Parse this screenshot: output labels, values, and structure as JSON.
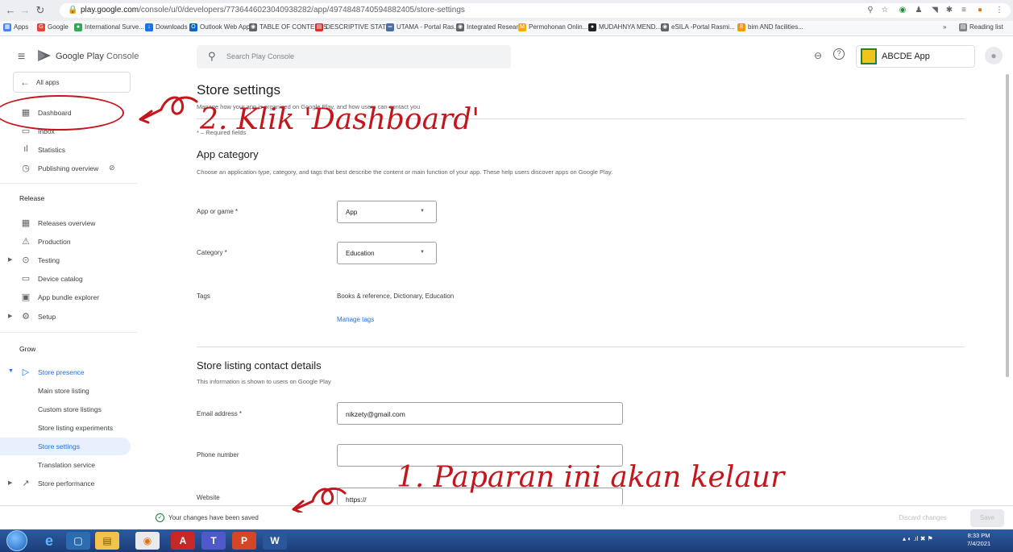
{
  "browser": {
    "url_prefix": "play.google.com",
    "url_rest": "/console/u/0/developers/7736446023040938282/app/4974848740594882405/store-settings",
    "bookmarks": [
      "Apps",
      "Google",
      "International Surve...",
      "Downloads",
      "Outlook Web App",
      "TABLE OF CONTENTS",
      "DESCRIPTIVE STATI...",
      "UTAMA - Portal Ras...",
      "Integrated Researc...",
      "Permohonan Onlin...",
      "MUDAHNYA MEND...",
      "eSILA -Portal Rasmi...",
      "bim AND facilities...",
      "»",
      "Reading list"
    ]
  },
  "header": {
    "brand_google": "Google Play",
    "brand_console": "Console",
    "search_placeholder": "Search Play Console",
    "app_name": "ABCDE App"
  },
  "sidebar": {
    "all_apps": "All apps",
    "items": [
      {
        "label": "Dashboard",
        "icon": "dashboard-icon"
      },
      {
        "label": "Inbox",
        "icon": "inbox-icon"
      },
      {
        "label": "Statistics",
        "icon": "statistics-icon"
      },
      {
        "label": "Publishing overview",
        "icon": "publishing-icon"
      }
    ],
    "release_header": "Release",
    "release_items": [
      {
        "label": "Releases overview"
      },
      {
        "label": "Production"
      },
      {
        "label": "Testing"
      },
      {
        "label": "Device catalog"
      },
      {
        "label": "App bundle explorer"
      },
      {
        "label": "Setup"
      }
    ],
    "grow_header": "Grow",
    "grow_items": [
      {
        "label": "Store presence"
      },
      {
        "label": "Main store listing"
      },
      {
        "label": "Custom store listings"
      },
      {
        "label": "Store listing experiments"
      },
      {
        "label": "Store settings"
      },
      {
        "label": "Translation service"
      },
      {
        "label": "Store performance"
      }
    ]
  },
  "main": {
    "title": "Store settings",
    "subtitle": "Manage how your app is organized on Google Play, and how users can contact you",
    "required_note": "* – Required fields",
    "app_category": {
      "title": "App category",
      "description": "Choose an application type, category, and tags that best describe the content or main function of your app. These help users discover apps on Google Play.",
      "app_or_game_label": "App or game *",
      "app_or_game_value": "App",
      "category_label": "Category *",
      "category_value": "Education",
      "tags_label": "Tags",
      "tags_value": "Books & reference, Dictionary, Education",
      "manage_tags": "Manage tags"
    },
    "contact": {
      "title": "Store listing contact details",
      "description": "This information is shown to users on Google Play",
      "email_label": "Email address *",
      "email_value": "nikzety@gmail.com",
      "phone_label": "Phone number",
      "phone_value": "",
      "website_label": "Website",
      "website_value": "https://"
    }
  },
  "footer": {
    "saved_message": "Your changes have been saved",
    "discard": "Discard changes",
    "save": "Save"
  },
  "taskbar": {
    "time": "8:33 PM",
    "date": "7/4/2021"
  },
  "annotations": {
    "step2": "2. Klik 'Dashboard'",
    "step1": "1. Paparan ini akan kelaur"
  },
  "colors": {
    "accent": "#1a73e8",
    "annotation": "#c4161c",
    "selected_bg": "#e8f0fe"
  }
}
